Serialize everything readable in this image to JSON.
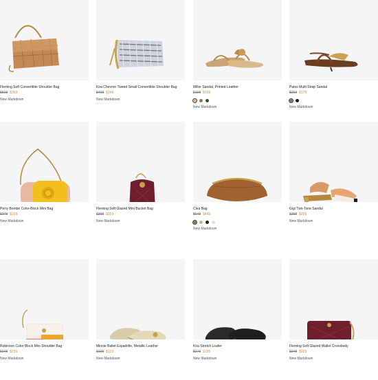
{
  "products": [
    {
      "title": "Fleming Soft Convertible Shoulder Bag",
      "old_price": "$528",
      "price": "$369",
      "badge": "New Markdown",
      "swatches": []
    },
    {
      "title": "Kira Chevron Tweed Small Convertible Shoulder Bag",
      "old_price": "$498",
      "price": "$349",
      "badge": "New Markdown",
      "swatches": []
    },
    {
      "title": "Miller Sandal, Printed Leather",
      "old_price": "$198",
      "price": "$169",
      "badge": "New Markdown",
      "swatches": [
        "#d9b98a",
        "#8c7a5a",
        "#3d4a4a"
      ]
    },
    {
      "title": "Patos Multi Strap Sandal",
      "old_price": "$258",
      "price": "$179",
      "badge": "New Markdown",
      "swatches": [
        "#7a7a7a",
        "#1e1e1e"
      ]
    },
    {
      "title": "Perry Bombé Color-Block Mini Bag",
      "old_price": "$278",
      "price": "$209",
      "badge": "New Markdown",
      "swatches": []
    },
    {
      "title": "Fleming Soft Glazed Mini Bucket Bag",
      "old_price": "$368",
      "price": "$259",
      "badge": "New Markdown",
      "swatches": []
    },
    {
      "title": "Clea Bag",
      "old_price": "$648",
      "price": "$449",
      "badge": "New Markdown",
      "swatches": [
        "#a0724a",
        "#c9b48e",
        "#1e1e1e",
        "#f2d6d6"
      ]
    },
    {
      "title": "Gigi Two-Tone Sandal",
      "old_price": "$298",
      "price": "$209",
      "badge": "New Markdown",
      "swatches": []
    },
    {
      "title": "Robinson Color Block Mini Shoulder Bag",
      "old_price": "$348",
      "price": "$239",
      "badge": "New Markdown",
      "swatches": []
    },
    {
      "title": "Minnie Ballet Espadrille, Metallic Leather",
      "old_price": "$198",
      "price": "$129",
      "badge": "New Markdown",
      "swatches": []
    },
    {
      "title": "Kira Stretch Loafer",
      "old_price": "$278",
      "price": "$189",
      "badge": "New Markdown",
      "swatches": []
    },
    {
      "title": "Fleming Soft Glazed Wallet Crossbody",
      "old_price": "$348",
      "price": "$209",
      "badge": "New Markdown",
      "swatches": []
    }
  ],
  "colors": {
    "sale": "#e0893a",
    "tile_bg": "#f5f5f7"
  }
}
